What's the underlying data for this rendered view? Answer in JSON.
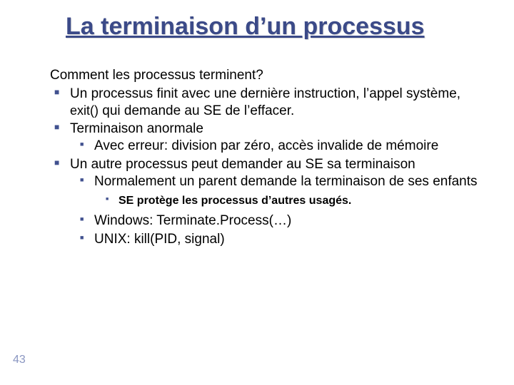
{
  "title": "La terminaison d’un processus",
  "intro": "Comment les processus terminent?",
  "bullets": [
    {
      "text_a": "Un processus finit avec une dernière instruction, l’appel système, ",
      "text_code": "exit()",
      "text_b": " qui demande au SE de l’effacer."
    },
    {
      "text": "Terminaison anormale",
      "children": [
        {
          "text": "Avec erreur: division par zéro, accès invalide de mémoire"
        }
      ]
    },
    {
      "text": "Un autre processus peut demander au SE sa terminaison",
      "children": [
        {
          "text": "Normalement un parent demande la terminaison de ses enfants",
          "children": [
            {
              "text": "SE protège les processus d’autres usagés."
            }
          ]
        },
        {
          "text": " Windows: Terminate.Process(…)"
        },
        {
          "text": "UNIX: kill(PID, signal)"
        }
      ]
    }
  ],
  "page_number": "43"
}
